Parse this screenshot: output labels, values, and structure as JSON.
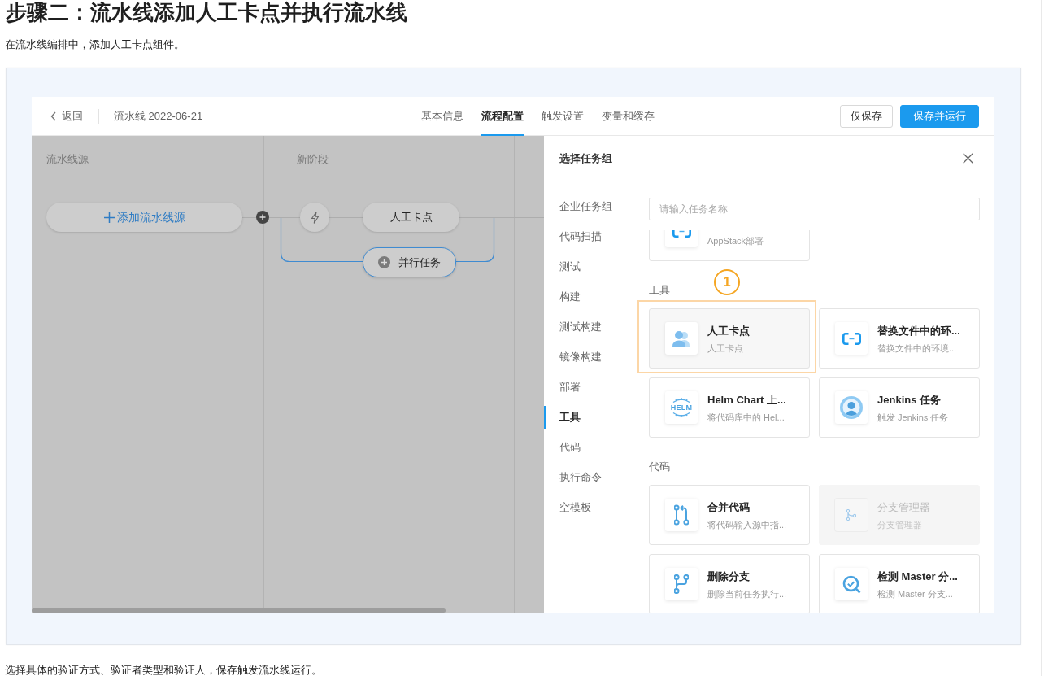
{
  "heading": "步骤二：流水线添加人工卡点并执行流水线",
  "intro": "在流水线编排中，添加人工卡点组件。",
  "screenshot": {
    "header": {
      "back": "返回",
      "pipeline_name": "流水线 2022-06-21",
      "tabs": [
        {
          "label": "基本信息",
          "selected": false
        },
        {
          "label": "流程配置",
          "selected": true
        },
        {
          "label": "触发设置",
          "selected": false
        },
        {
          "label": "变量和缓存",
          "selected": false
        }
      ],
      "buttons": [
        {
          "label": "仅保存",
          "kind": "default"
        },
        {
          "label": "保存并运行",
          "kind": "primary"
        }
      ]
    },
    "canvas": {
      "stages": [
        {
          "title": "流水线源"
        },
        {
          "title": "新阶段"
        }
      ],
      "source_button": "添加流水线源",
      "task": "人工卡点",
      "parallel_button": "并行任务"
    },
    "drawer": {
      "title": "选择任务组",
      "categories": [
        {
          "label": "企业任务组",
          "selected": false
        },
        {
          "label": "代码扫描",
          "selected": false
        },
        {
          "label": "测试",
          "selected": false
        },
        {
          "label": "构建",
          "selected": false
        },
        {
          "label": "测试构建",
          "selected": false
        },
        {
          "label": "镜像构建",
          "selected": false
        },
        {
          "label": "部署",
          "selected": false
        },
        {
          "label": "工具",
          "selected": true
        },
        {
          "label": "代码",
          "selected": false
        },
        {
          "label": "执行命令",
          "selected": false
        },
        {
          "label": "空模板",
          "selected": false
        }
      ],
      "search": {
        "placeholder": "请输入任务名称"
      },
      "sections": [
        {
          "cards": [
            {
              "description": "AppStack部署",
              "kind": "bracket",
              "disabled": false
            }
          ]
        },
        {
          "title": "工具",
          "cards": [
            {
              "title": "人工卡点",
              "description": "人工卡点",
              "kind": "people",
              "disabled": false,
              "annotation": "1"
            },
            {
              "title": "替换文件中的环...",
              "description": "替换文件中的环境...",
              "kind": "bracket",
              "disabled": false
            },
            {
              "title": "Helm Chart 上...",
              "description": "将代码库中的 Hel...",
              "kind": "helm",
              "logo_text": "HELM",
              "disabled": false
            },
            {
              "title": "Jenkins 任务",
              "description": "触发 Jenkins 任务",
              "kind": "avatar",
              "disabled": false
            }
          ]
        },
        {
          "title": "代码",
          "cards": [
            {
              "title": "合并代码",
              "description": "将代码输入源中指...",
              "kind": "merge",
              "disabled": false
            },
            {
              "title": "分支管理器",
              "description": "分支管理器",
              "kind": "branch",
              "disabled": true
            },
            {
              "title": "删除分支",
              "description": "删除当前任务执行...",
              "kind": "fork",
              "disabled": false
            },
            {
              "title": "检测 Master 分...",
              "description": "检测 Master 分支...",
              "kind": "check",
              "disabled": false
            }
          ]
        }
      ]
    }
  },
  "outro": "选择具体的验证方式、验证者类型和验证人，保存触发流水线运行。"
}
